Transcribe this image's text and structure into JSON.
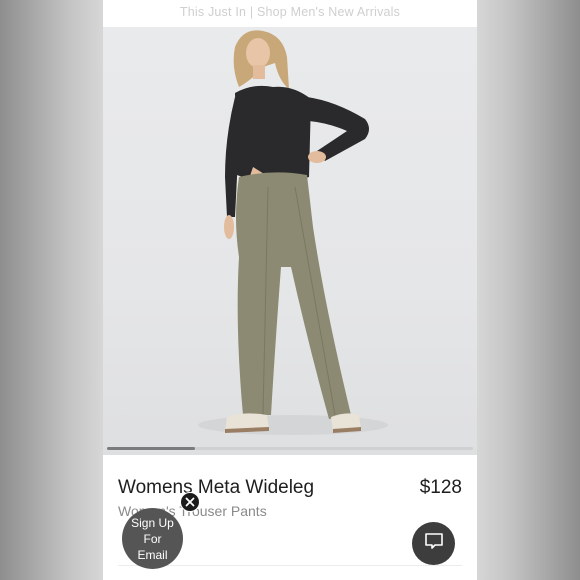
{
  "promo_banner": {
    "text": "This Just In | Shop Men's New Arrivals"
  },
  "gallery": {
    "progress": 0.24
  },
  "product": {
    "name": "Womens Meta Wideleg",
    "price": "$128",
    "subtitle": "Women's Trouser Pants"
  },
  "signup_bubble": {
    "line1": "Sign Up",
    "line2": "For",
    "line3": "Email"
  },
  "icons": {
    "close": "close-icon",
    "chat": "chat-icon"
  }
}
